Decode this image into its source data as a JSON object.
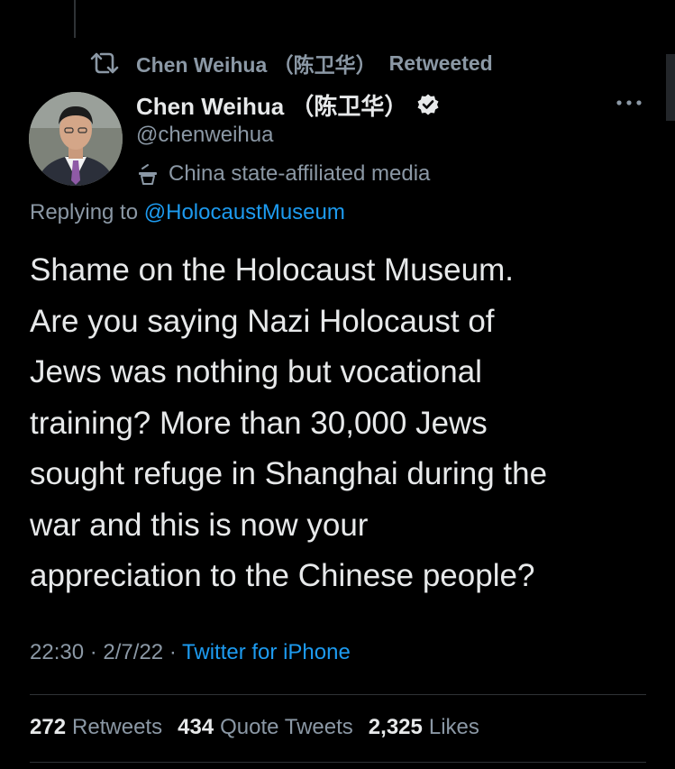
{
  "retweet_banner": {
    "icon": "retweet-icon",
    "name": "Chen Weihua （陈卫华）",
    "label": "Retweeted"
  },
  "author": {
    "avatar": "profile-photo",
    "display_name": "Chen Weihua （陈卫华）",
    "verified_icon": "verified-badge-icon",
    "handle": "@chenweihua",
    "affiliation_icon": "state-media-podium-icon",
    "affiliation": "China state-affiliated media"
  },
  "more_icon": "more-options-icon",
  "reply": {
    "prefix": "Replying to",
    "mention": "@HolocaustMuseum"
  },
  "tweet": {
    "text": "Shame on the Holocaust Museum.\nAre you saying Nazi Holocaust of\nJews was nothing but vocational\ntraining? More than 30,000 Jews\nsought refuge in Shanghai during the\nwar and this is now your\nappreciation to the Chinese people?"
  },
  "meta": {
    "time": "22:30",
    "date": "2/7/22",
    "separator": "·",
    "source": "Twitter for iPhone"
  },
  "stats": {
    "retweets_count": "272",
    "retweets_label": "Retweets",
    "quotes_count": "434",
    "quotes_label": "Quote Tweets",
    "likes_count": "2,325",
    "likes_label": "Likes"
  },
  "colors": {
    "background": "#000000",
    "primary_text": "#e7e9ea",
    "secondary_text": "#8b98a5",
    "link": "#1d9bf0",
    "divider": "#2f3336"
  }
}
